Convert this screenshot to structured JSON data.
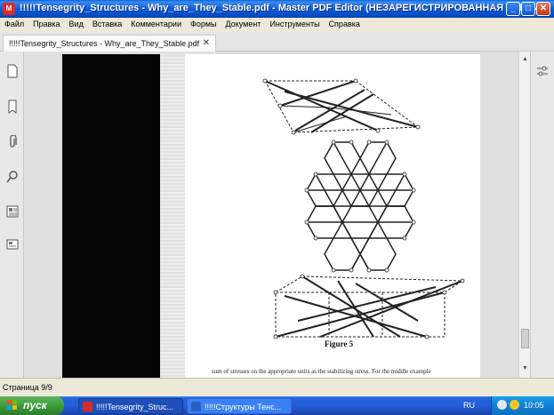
{
  "window": {
    "title": "!!!!!Tensegrity_Structures - Why_are_They_Stable.pdf - Master PDF Editor (НЕЗАРЕГИСТРИРОВАННАЯ ВЕРСИЯ)",
    "app_icon_glyph": "M",
    "minimize": "_",
    "maximize": "□",
    "close": "✕"
  },
  "menu": [
    "Файл",
    "Правка",
    "Вид",
    "Вставка",
    "Комментарии",
    "Формы",
    "Документ",
    "Инструменты",
    "Справка"
  ],
  "tabs": [
    {
      "label": "!!!!!Tensegrity_Structures - Why_are_They_Stable.pdf",
      "close": "✕"
    }
  ],
  "left_panel_icons": [
    "pages-icon",
    "bookmark-icon",
    "attachment-icon",
    "search-icon",
    "layers-icon",
    "form-fields-icon"
  ],
  "document": {
    "figure_caption": "Figure 5",
    "body_text": "sum of stresses on the appropriate units as the stabilizing stress. For the middle example"
  },
  "status": {
    "page_indicator": "Страница 9/9"
  },
  "taskbar": {
    "start_label": "пуск",
    "tasks": [
      {
        "label": "!!!!!Tensegrity_Struc...",
        "icon_color": "#d92b2b",
        "active": true
      },
      {
        "label": "!!!!!Структуры Тенс...",
        "icon_color": "#2b5fc2",
        "active": false
      }
    ],
    "language": "RU",
    "clock": "10:05"
  },
  "colors": {
    "titlebar": "#0b5ed8",
    "taskbar": "#245edb",
    "start": "#3c9b3c"
  }
}
